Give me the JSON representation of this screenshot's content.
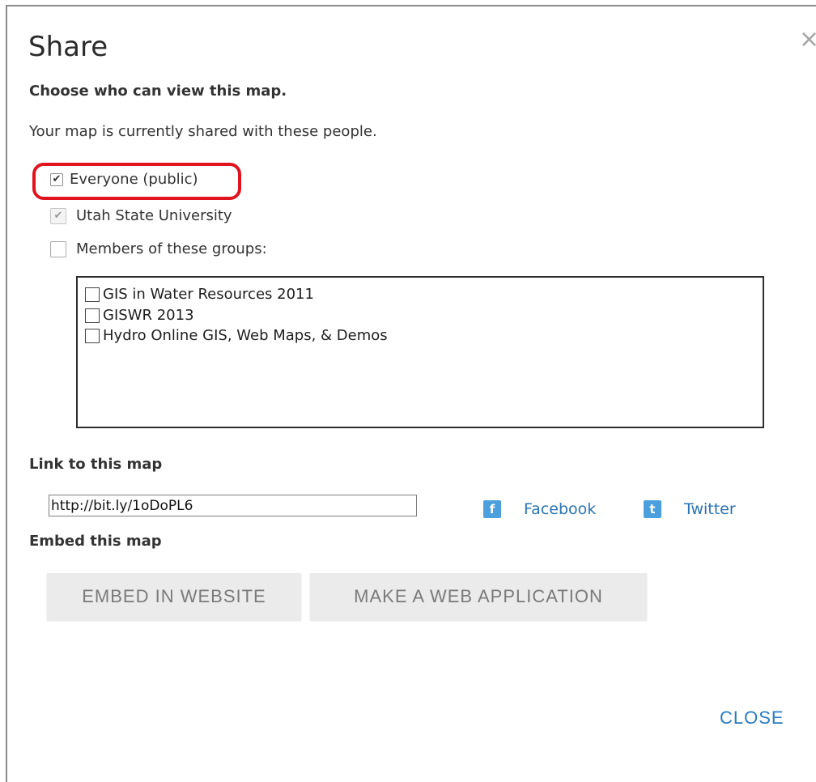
{
  "dialog": {
    "title": "Share",
    "close_icon": "×"
  },
  "share": {
    "heading": "Choose who can view this map.",
    "note": "Your map is currently shared with these people.",
    "options": [
      {
        "label": "Everyone (public)",
        "checked": true,
        "disabled": false
      },
      {
        "label": "Utah State University",
        "checked": true,
        "disabled": true
      },
      {
        "label": "Members of these groups:",
        "checked": false,
        "disabled": false
      }
    ],
    "groups": [
      {
        "label": "GIS in Water Resources 2011",
        "checked": false
      },
      {
        "label": "GISWR 2013",
        "checked": false
      },
      {
        "label": "Hydro Online GIS, Web Maps, & Demos",
        "checked": false
      }
    ]
  },
  "link": {
    "heading": "Link to this map",
    "url": "http://bit.ly/1oDoPL6",
    "facebook_icon": "f",
    "facebook_label": "Facebook",
    "twitter_icon": "t",
    "twitter_label": "Twitter"
  },
  "embed": {
    "heading": "Embed this map",
    "embed_button": "EMBED IN WEBSITE",
    "webapp_button": "MAKE A WEB APPLICATION"
  },
  "footer": {
    "close_label": "CLOSE"
  },
  "colors": {
    "highlight": "#e0141e",
    "link": "#2a7cc2",
    "social_icon": "#4a9fdc"
  }
}
